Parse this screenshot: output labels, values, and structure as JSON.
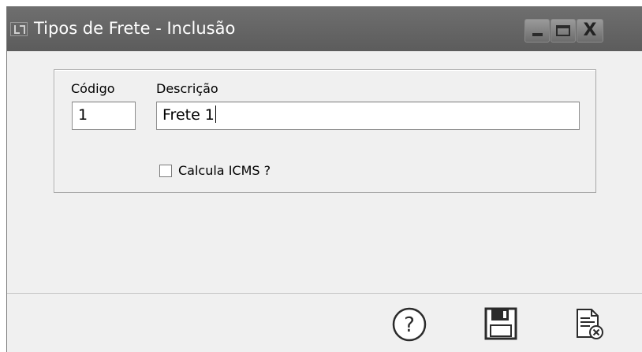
{
  "window": {
    "title": "Tipos de Frete - Inclusão",
    "app_icon": "app-icon",
    "controls": {
      "minimize": "minimize-icon",
      "maximize": "maximize-icon",
      "close_glyph": "X"
    }
  },
  "form": {
    "codigo": {
      "label": "Código",
      "value": "1"
    },
    "descricao": {
      "label": "Descrição",
      "value": "Frete 1"
    },
    "calcula_icms": {
      "label": "Calcula ICMS ?",
      "checked": false
    }
  },
  "footer": {
    "buttons": [
      {
        "icon": "help-icon",
        "glyph": "?"
      },
      {
        "icon": "save-icon"
      },
      {
        "icon": "cancel-document-icon"
      }
    ]
  },
  "colors": {
    "titlebar": "#5c5c5c",
    "body": "#f0f0f0",
    "title_text": "#ffffff"
  }
}
